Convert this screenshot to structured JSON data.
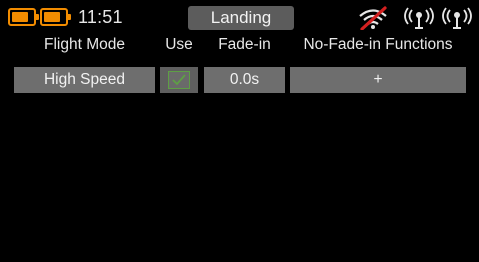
{
  "status_bar": {
    "time": "11:51",
    "battery_color": "#f28c00",
    "icons": {
      "transmitter_battery": "battery-icon",
      "receiver_battery": "battery-icon",
      "signal_disabled": "wifi-off-icon",
      "telemetry_1": "telemetry-antenna-icon",
      "telemetry_2": "telemetry-antenna-icon"
    }
  },
  "title": "Landing",
  "table": {
    "headers": {
      "flight_mode": "Flight Mode",
      "use": "Use",
      "fade_in": "Fade-in",
      "no_fade_in": "No-Fade-in Functions"
    },
    "rows": [
      {
        "flight_mode": "High Speed",
        "use_checked": true,
        "fade_in": "0.0s",
        "no_fade_in": "+"
      }
    ]
  },
  "colors": {
    "background": "#000000",
    "cell": "#6e6e6e",
    "title_pill": "#5c5c5c",
    "check": "#5e9f45",
    "warning_red": "#d42020"
  }
}
